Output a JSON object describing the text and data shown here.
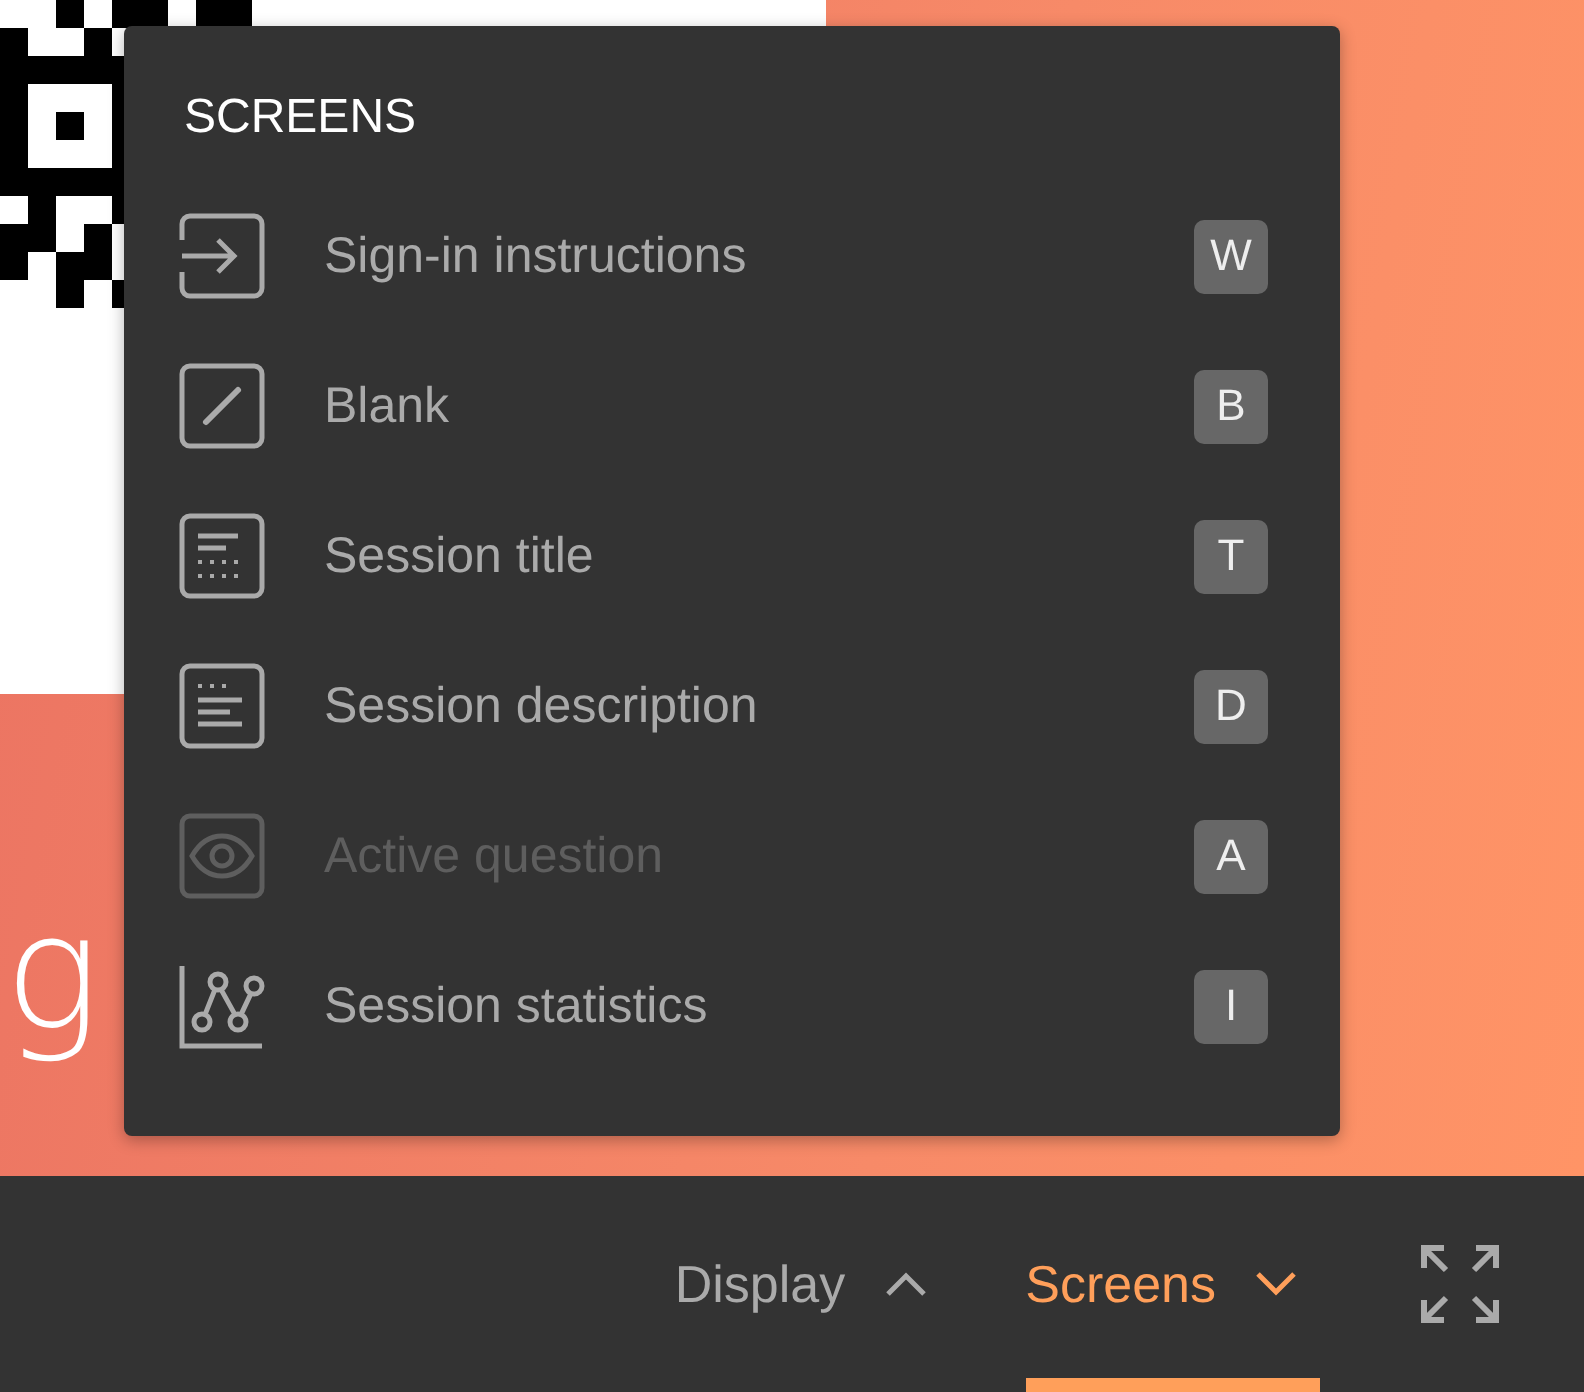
{
  "slide": {
    "text": "g"
  },
  "menu": {
    "title": "SCREENS",
    "items": [
      {
        "kind": "sign-in",
        "label": "Sign-in instructions",
        "key": "W",
        "disabled": false
      },
      {
        "kind": "blank",
        "label": "Blank",
        "key": "B",
        "disabled": false
      },
      {
        "kind": "title",
        "label": "Session title",
        "key": "T",
        "disabled": false
      },
      {
        "kind": "description",
        "label": "Session description",
        "key": "D",
        "disabled": false
      },
      {
        "kind": "question",
        "label": "Active question",
        "key": "A",
        "disabled": true
      },
      {
        "kind": "statistics",
        "label": "Session statistics",
        "key": "I",
        "disabled": false
      }
    ]
  },
  "toolbar": {
    "buttons": [
      {
        "label": "Display",
        "selected": false
      },
      {
        "label": "Screens",
        "selected": true
      }
    ]
  }
}
